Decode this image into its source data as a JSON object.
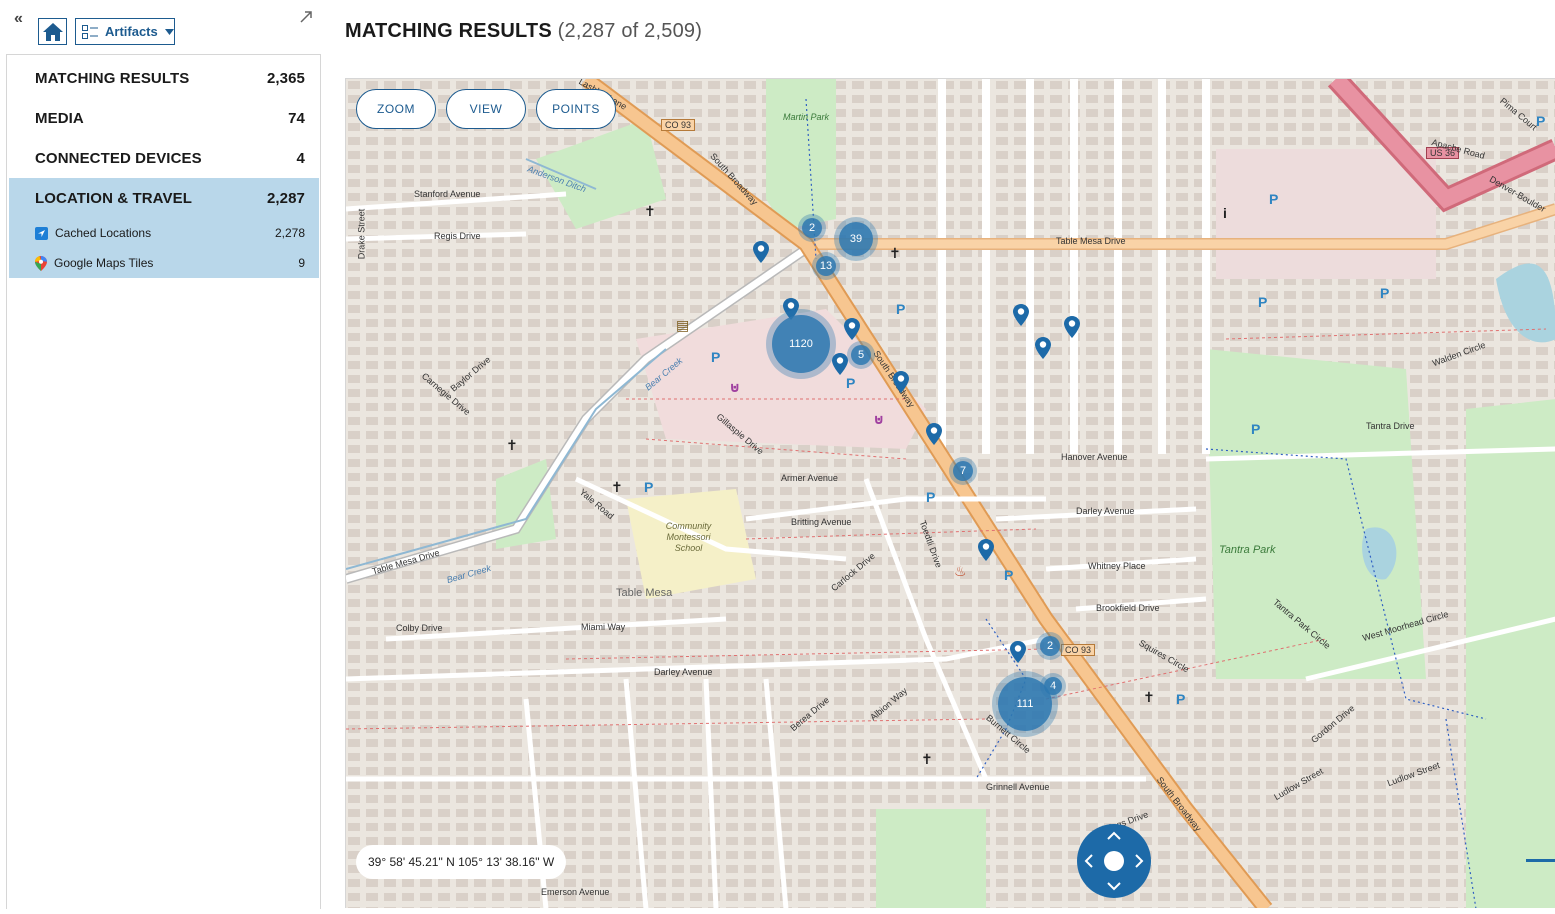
{
  "toolbar": {
    "artifacts_label": "Artifacts"
  },
  "nav": {
    "items": [
      {
        "label": "MATCHING RESULTS",
        "count": "2,365"
      },
      {
        "label": "MEDIA",
        "count": "74"
      },
      {
        "label": "CONNECTED DEVICES",
        "count": "4"
      },
      {
        "label": "LOCATION & TRAVEL",
        "count": "2,287"
      }
    ],
    "sub_items": [
      {
        "label": "Cached Locations",
        "count": "2,278",
        "icon": "location-arrow-icon"
      },
      {
        "label": "Google Maps Tiles",
        "count": "9",
        "icon": "google-maps-pin-icon"
      }
    ]
  },
  "header": {
    "title": "MATCHING RESULTS",
    "count": "(2,287 of 2,509)"
  },
  "map": {
    "buttons": {
      "zoom": "ZOOM",
      "view": "VIEW",
      "points": "POINTS"
    },
    "coordinates": "39° 58' 45.21\" N 105° 13' 38.16\" W",
    "clusters": [
      "2",
      "39",
      "13",
      "1120",
      "5",
      "7",
      "2",
      "4",
      "111"
    ],
    "labels": {
      "table_mesa_drive": "Table Mesa Drive",
      "south_broadway": "South Broadway",
      "co93": "CO 93",
      "us36": "US 36",
      "stanford_ave": "Stanford Avenue",
      "regis": "Regis Drive",
      "anderson": "Anderson Ditch",
      "bear_creek": "Bear Creek",
      "gillaspie": "Gillaspie Drive",
      "armer": "Armer Avenue",
      "britting": "Britting Avenue",
      "montessori": "Community Montessori School",
      "table_mesa": "Table Mesa",
      "colby": "Colby Drive",
      "miami": "Miami Way",
      "darley": "Darley Avenue",
      "hanover": "Hanover Avenue",
      "whitney": "Whitney Place",
      "brookfield": "Brookfield Drive",
      "tantra_park": "Tantra Park",
      "tantra_drive": "Tantra Drive",
      "grinnell": "Grinnell Avenue",
      "emerson": "Emerson Avenue",
      "martin_park": "Martin Park",
      "denver_boulder": "Denver-Boulder",
      "west_moorhead": "West Moorhead Circle",
      "yale_road": "Yale Road",
      "drake_street": "Drake Street",
      "carnegie": "Carnegie Drive",
      "baylor": "Baylor Drive",
      "carlock": "Carlock Drive",
      "toedtli": "Toedtli Drive",
      "albion": "Albion Way",
      "berea": "Berea Drive",
      "hastings": "Hastings Drive",
      "ludlow": "Ludlow Street",
      "gordon": "Gordon Drive",
      "pima": "Pima Court",
      "walden": "Walden Circle",
      "apache": "Apache Road",
      "lashley": "Lashley Lane",
      "squires": "Squires Circle",
      "tantra_park_circle": "Tantra Park Circle",
      "burnett": "Burnett Circle"
    }
  }
}
